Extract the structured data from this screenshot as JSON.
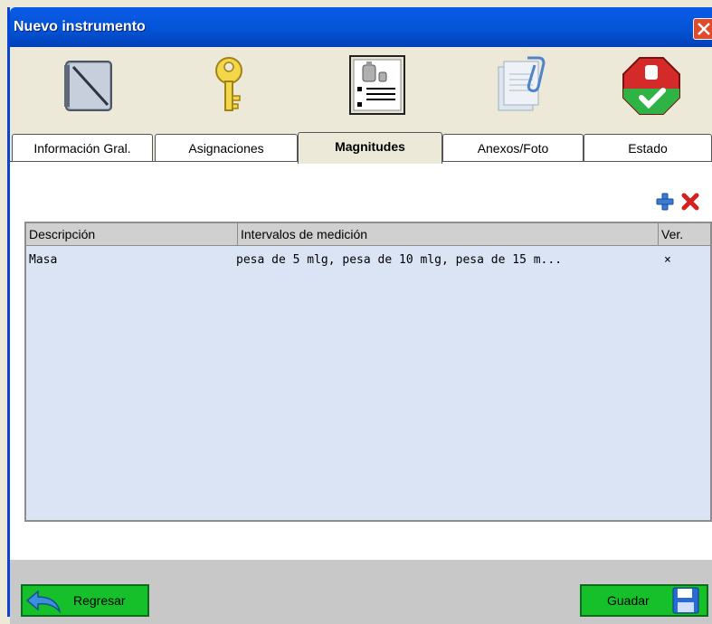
{
  "window": {
    "title": "Nuevo instrumento"
  },
  "toolbar_icons": [
    {
      "name": "notebook-icon"
    },
    {
      "name": "key-icon"
    },
    {
      "name": "weights-list-icon"
    },
    {
      "name": "attachments-icon"
    },
    {
      "name": "status-approve-icon"
    }
  ],
  "tabs": [
    {
      "label": "Información Gral."
    },
    {
      "label": "Asignaciones"
    },
    {
      "label": "Magnitudes",
      "active": true
    },
    {
      "label": "Anexos/Foto"
    },
    {
      "label": "Estado"
    }
  ],
  "grid": {
    "columns": [
      "Descripción",
      "Intervalos de medición",
      "Ver."
    ],
    "rows": [
      {
        "descripcion": "Masa",
        "intervalos": "pesa de 5 mlg, pesa de 10 mlg, pesa de 15 m...",
        "ver": "×"
      }
    ]
  },
  "buttons": {
    "back": "Regresar",
    "save": "Guadar"
  },
  "colors": {
    "titlebar": "#0454d7",
    "button_green": "#15c02a",
    "grid_background": "#dbe4f5"
  }
}
